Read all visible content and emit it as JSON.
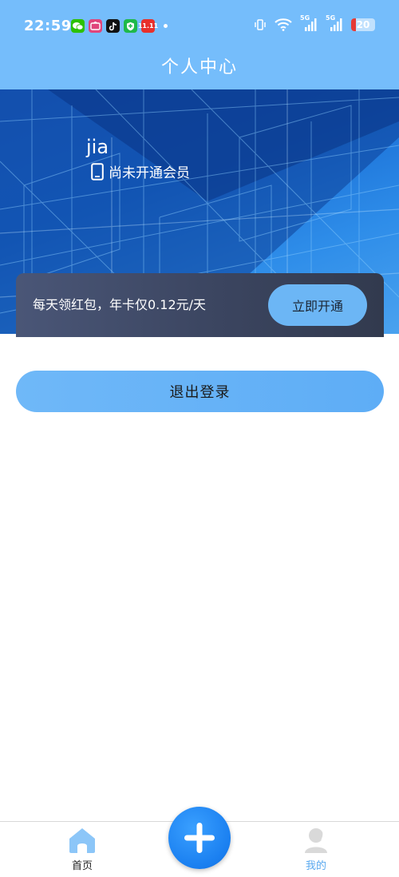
{
  "status_bar": {
    "time": "22:59",
    "battery_level": "20",
    "battery_color": "#e53935",
    "signal_label_1": "5G",
    "signal_label_2": "5G",
    "app_icons": [
      "wechat-icon",
      "app-icon",
      "tiktok-icon",
      "shield-app-icon",
      "taobao-11-icon"
    ],
    "app_icon_11_label": "11.11"
  },
  "header": {
    "title": "个人中心",
    "background": "#75bdfb"
  },
  "profile": {
    "username": "jia",
    "member_status": "尚未开通会员"
  },
  "vip": {
    "promo_text": "每天领红包，年卡仅0.12元/天",
    "button_label": "立即开通"
  },
  "actions": {
    "logout_label": "退出登录"
  },
  "nav": {
    "home_label": "首页",
    "mine_label": "我的",
    "active": "我的",
    "active_color": "#5aa9ef",
    "fab_icon": "plus-icon"
  }
}
